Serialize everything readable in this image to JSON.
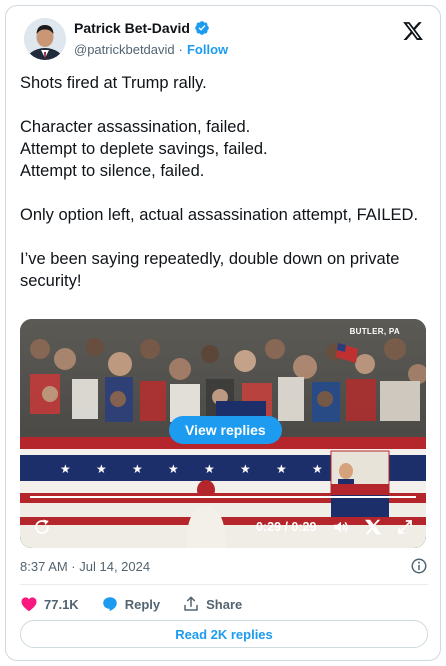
{
  "author": {
    "name": "Patrick Bet-David",
    "handle": "@patrickbetdavid",
    "separator": "·",
    "follow_label": "Follow"
  },
  "tweet": {
    "text": "Shots fired at Trump rally.\n\nCharacter assassination, failed.\nAttempt to deplete savings, failed.\nAttempt to silence, failed.\n\nOnly option left, actual assassination attempt, FAILED.\n\nI’ve been saying repeatedly, double down on private security!"
  },
  "media": {
    "location_label": "BUTLER, PA",
    "view_replies_label": "View replies",
    "timecode": "0:29 / 0:29",
    "progress": 1.0
  },
  "meta": {
    "timestamp": "8:37 AM · Jul 14, 2024"
  },
  "actions": {
    "likes": "77.1K",
    "reply_label": "Reply",
    "share_label": "Share"
  },
  "read_replies_label": "Read 2K replies",
  "colors": {
    "accent": "#1d9bf0",
    "like": "#f91880",
    "text": "#0f1419",
    "muted": "#536471"
  },
  "icons": [
    "verified-badge-icon",
    "x-logo-icon",
    "replay-icon",
    "volume-icon",
    "fullscreen-icon",
    "info-icon",
    "heart-icon",
    "reply-bubble-icon",
    "share-icon"
  ]
}
